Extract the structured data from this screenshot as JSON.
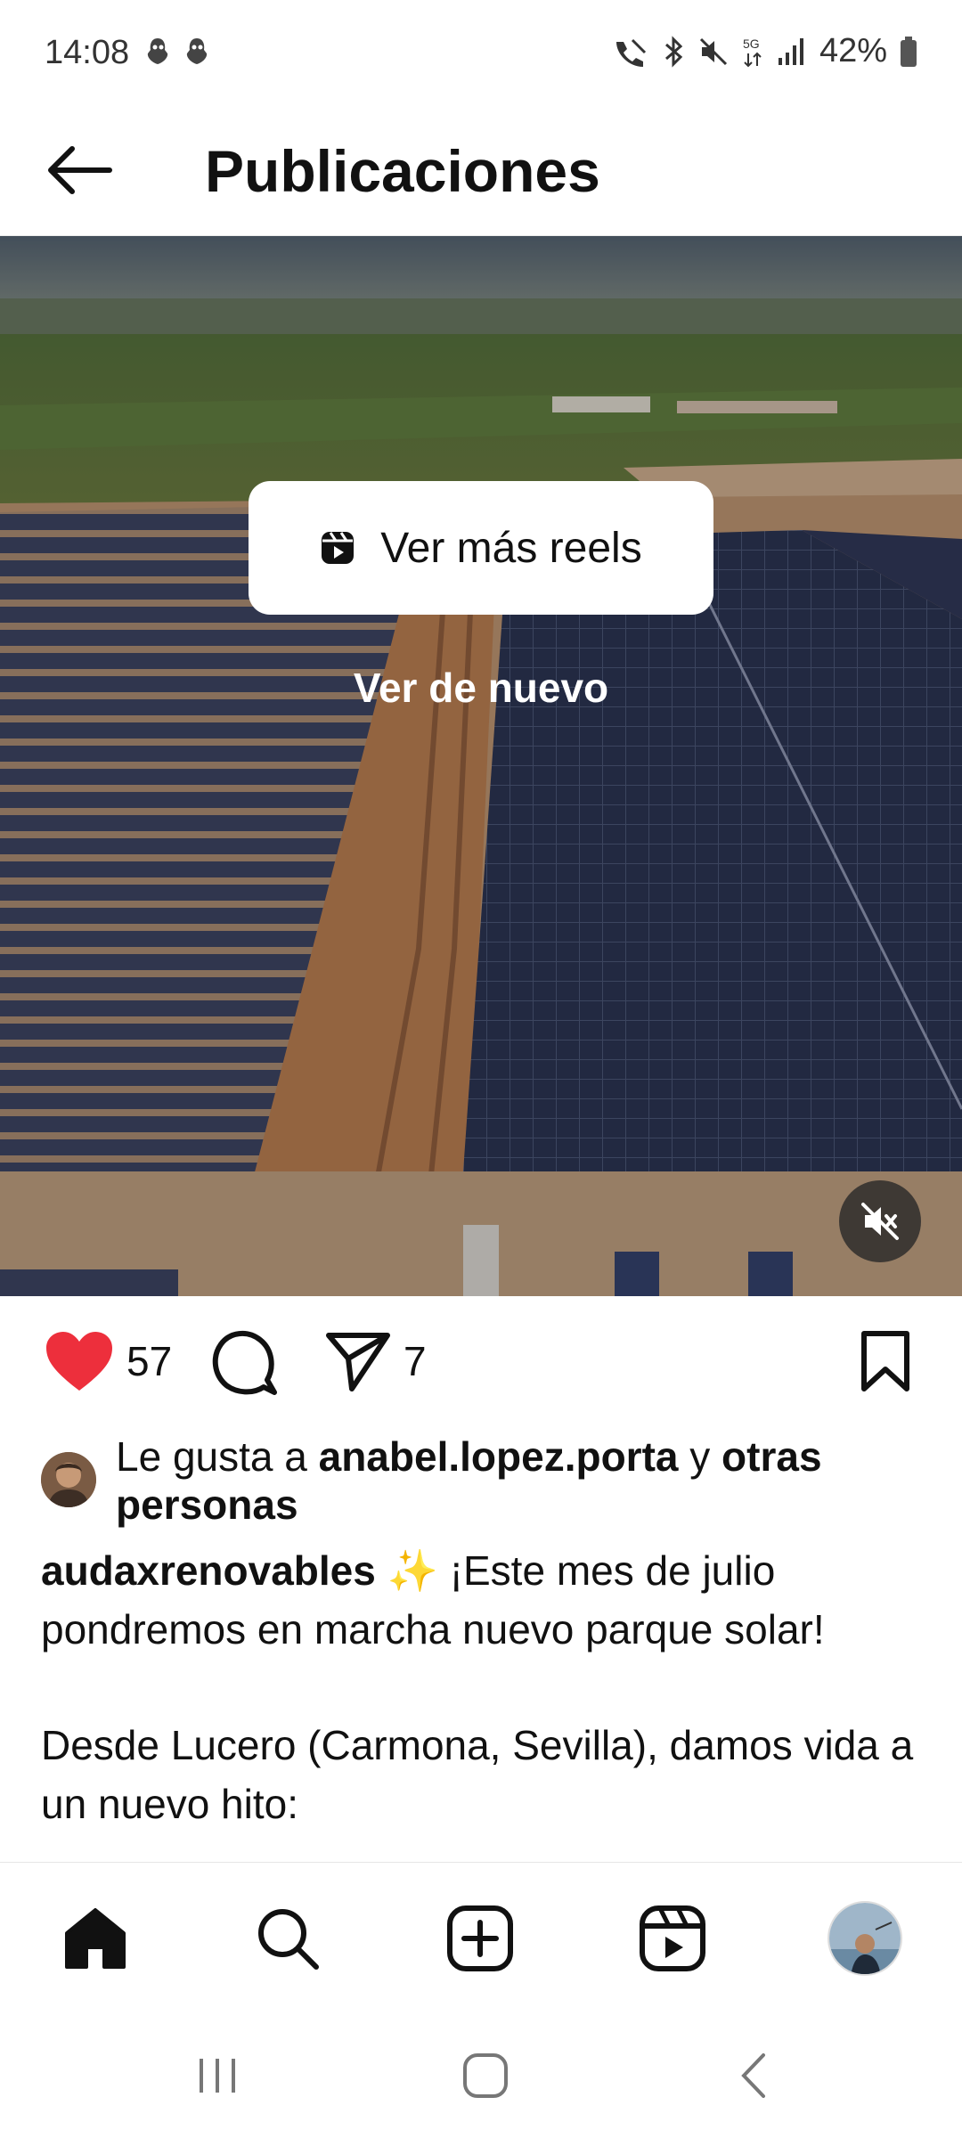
{
  "status_bar": {
    "time": "14:08",
    "network": "5G",
    "battery": "42%"
  },
  "header": {
    "title": "Publicaciones"
  },
  "media": {
    "more_reels_label": "Ver más reels",
    "replay_label": "Ver de nuevo"
  },
  "actions": {
    "like_count": "57",
    "share_count": "7",
    "like_color": "#ed2f3c"
  },
  "likes": {
    "prefix": "Le gusta a ",
    "user": "anabel.lopez.porta",
    "middle": " y ",
    "others": "otras personas"
  },
  "caption": {
    "username": "audaxrenovables",
    "emoji": "✨",
    "line1": " ¡Este mes de julio pondremos en marcha nuevo parque solar!",
    "line2": "Desde Lucero (Carmona, Sevilla), damos vida a un nuevo hito:"
  },
  "bottom_nav": {
    "items": [
      "home",
      "search",
      "create",
      "reels",
      "profile"
    ]
  },
  "system_nav": {
    "items": [
      "recents",
      "home",
      "back"
    ]
  }
}
